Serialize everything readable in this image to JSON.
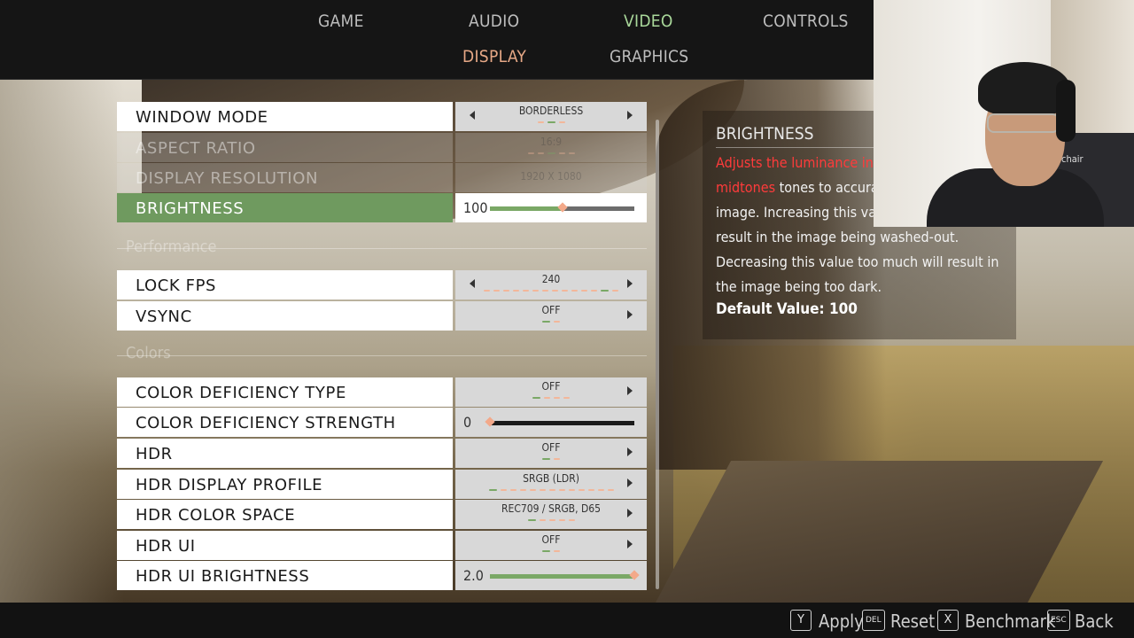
{
  "nav": {
    "main_tabs": [
      "GAME",
      "AUDIO",
      "VIDEO",
      "CONTROLS"
    ],
    "active_main_tab": "VIDEO",
    "sub_tabs": [
      "DISPLAY",
      "GRAPHICS"
    ],
    "active_sub_tab": "DISPLAY"
  },
  "settings": {
    "window_mode": {
      "label": "WINDOW MODE",
      "value": "BORDERLESS"
    },
    "aspect_ratio": {
      "label": "ASPECT RATIO",
      "value": "16:9"
    },
    "display_resolution": {
      "label": "DISPLAY RESOLUTION",
      "value": "1920 x 1080"
    },
    "brightness": {
      "label": "BRIGHTNESS",
      "value": "100",
      "fraction": 0.5
    },
    "section_performance": "Performance",
    "lock_fps": {
      "label": "LOCK FPS",
      "value": "240"
    },
    "vsync": {
      "label": "VSYNC",
      "value": "OFF"
    },
    "section_colors": "Colors",
    "color_deficiency_type": {
      "label": "COLOR DEFICIENCY TYPE",
      "value": "OFF"
    },
    "color_deficiency_strength": {
      "label": "COLOR DEFICIENCY STRENGTH",
      "value": "0",
      "fraction": 0.0
    },
    "hdr": {
      "label": "HDR",
      "value": "OFF"
    },
    "hdr_display_profile": {
      "label": "HDR DISPLAY PROFILE",
      "value": "SRGB (LDR)"
    },
    "hdr_color_space": {
      "label": "HDR COLOR SPACE",
      "value": "REC709 / SRGB, D65"
    },
    "hdr_ui": {
      "label": "HDR UI",
      "value": "OFF"
    },
    "hdr_ui_brightness": {
      "label": "HDR UI BRIGHTNESS",
      "value": "2.0",
      "fraction": 1.0
    }
  },
  "description": {
    "title": "BRIGHTNESS",
    "highlight": "Adjusts the luminance intensity of the midtones",
    "body": " tones to accurately reproduce the image. Increasing this value too much will result in the image being washed-out. Decreasing this value too much will result in the image being too dark.",
    "default_value": "Default Value: 100"
  },
  "webcam": {
    "chair_text": "chair"
  },
  "footer": {
    "hints": [
      {
        "key": "Y",
        "label": "Apply"
      },
      {
        "key": "DEL",
        "label": "Reset"
      },
      {
        "key": "X",
        "label": "Benchmark"
      },
      {
        "key": "ESC",
        "label": "Back"
      }
    ]
  },
  "colors": {
    "accent_green": "#6f9a5f",
    "active_tab_green": "#a9d89a",
    "active_subtab_orange": "#e6a886",
    "description_highlight_red": "#ff3b3b",
    "slider_knob": "#f3a98a"
  }
}
